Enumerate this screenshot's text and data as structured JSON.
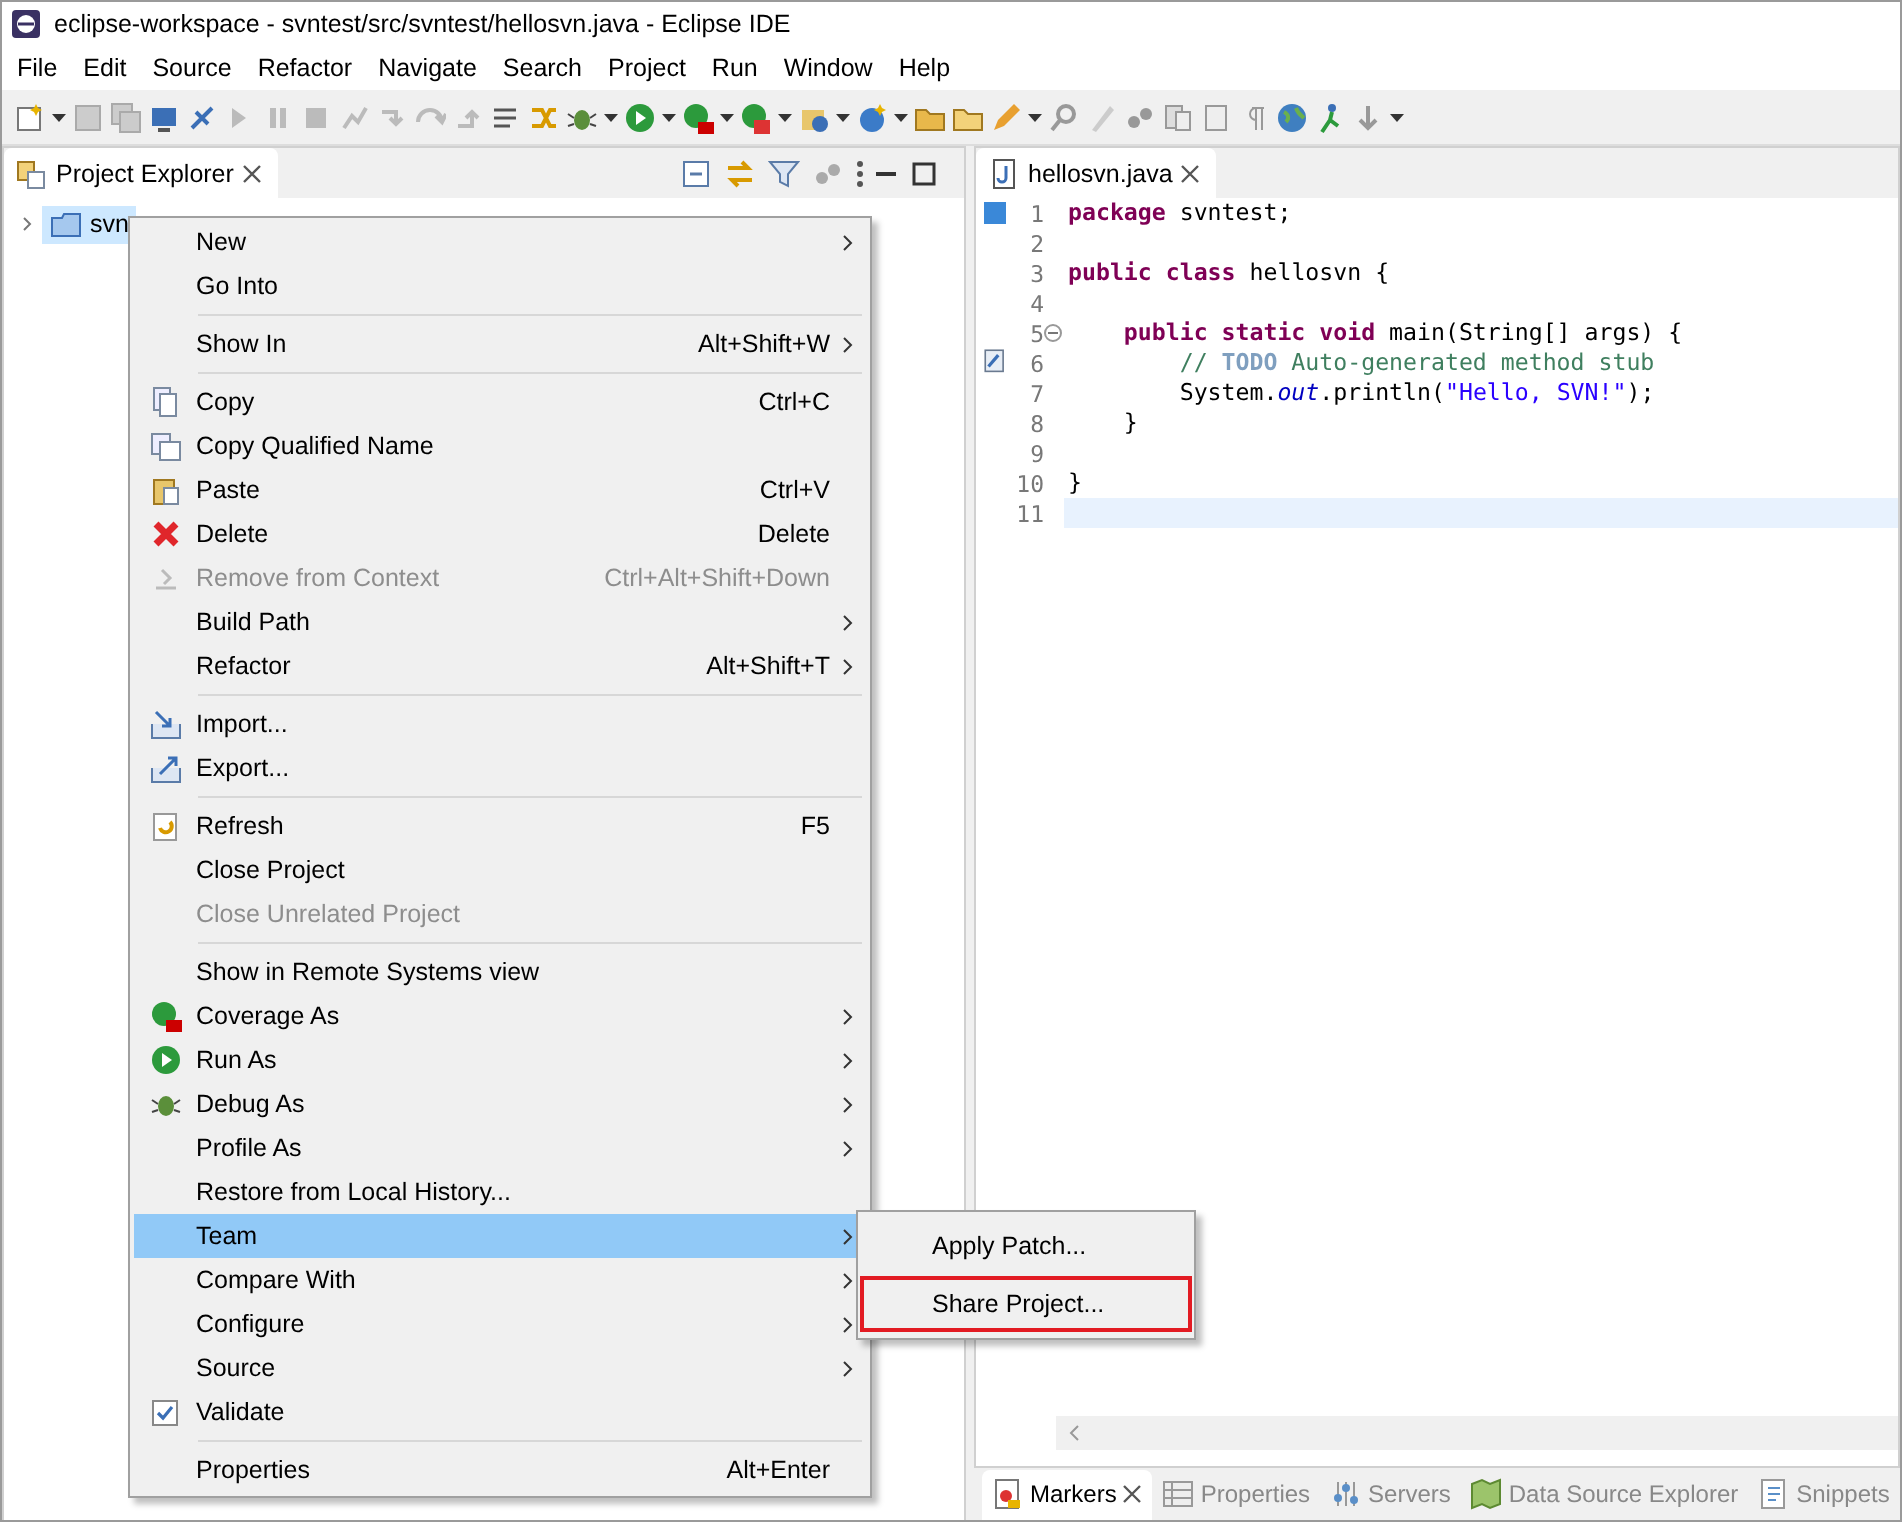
{
  "window": {
    "title": "eclipse-workspace - svntest/src/svntest/hellosvn.java - Eclipse IDE"
  },
  "menubar": [
    "File",
    "Edit",
    "Source",
    "Refactor",
    "Navigate",
    "Search",
    "Project",
    "Run",
    "Window",
    "Help"
  ],
  "explorer": {
    "tab": {
      "label": "Project Explorer",
      "selected": true
    },
    "tree": [
      {
        "label": "svn",
        "expanded": false,
        "selected": true
      }
    ]
  },
  "context_menu": [
    {
      "kind": "item",
      "label": "New",
      "submenu": true,
      "disabled": false,
      "selected": false
    },
    {
      "kind": "item",
      "label": "Go Into",
      "submenu": false,
      "disabled": false,
      "selected": false
    },
    {
      "kind": "separator"
    },
    {
      "kind": "item",
      "label": "Show In",
      "shortcut": "Alt+Shift+W",
      "submenu": true,
      "disabled": false,
      "selected": false
    },
    {
      "kind": "separator"
    },
    {
      "kind": "item",
      "label": "Copy",
      "shortcut": "Ctrl+C",
      "submenu": false,
      "disabled": false,
      "selected": false
    },
    {
      "kind": "item",
      "label": "Copy Qualified Name",
      "submenu": false,
      "disabled": false,
      "selected": false
    },
    {
      "kind": "item",
      "label": "Paste",
      "shortcut": "Ctrl+V",
      "submenu": false,
      "disabled": false,
      "selected": false
    },
    {
      "kind": "item",
      "label": "Delete",
      "shortcut": "Delete",
      "submenu": false,
      "disabled": false,
      "selected": false
    },
    {
      "kind": "item",
      "label": "Remove from Context",
      "shortcut": "Ctrl+Alt+Shift+Down",
      "submenu": false,
      "disabled": true,
      "selected": false
    },
    {
      "kind": "item",
      "label": "Build Path",
      "submenu": true,
      "disabled": false,
      "selected": false
    },
    {
      "kind": "item",
      "label": "Refactor",
      "shortcut": "Alt+Shift+T",
      "submenu": true,
      "disabled": false,
      "selected": false
    },
    {
      "kind": "separator"
    },
    {
      "kind": "item",
      "label": "Import...",
      "submenu": false,
      "disabled": false,
      "selected": false
    },
    {
      "kind": "item",
      "label": "Export...",
      "submenu": false,
      "disabled": false,
      "selected": false
    },
    {
      "kind": "separator"
    },
    {
      "kind": "item",
      "label": "Refresh",
      "shortcut": "F5",
      "submenu": false,
      "disabled": false,
      "selected": false
    },
    {
      "kind": "item",
      "label": "Close Project",
      "submenu": false,
      "disabled": false,
      "selected": false
    },
    {
      "kind": "item",
      "label": "Close Unrelated Project",
      "submenu": false,
      "disabled": true,
      "selected": false
    },
    {
      "kind": "separator"
    },
    {
      "kind": "item",
      "label": "Show in Remote Systems view",
      "submenu": false,
      "disabled": false,
      "selected": false
    },
    {
      "kind": "item",
      "label": "Coverage As",
      "submenu": true,
      "disabled": false,
      "selected": false
    },
    {
      "kind": "item",
      "label": "Run As",
      "submenu": true,
      "disabled": false,
      "selected": false
    },
    {
      "kind": "item",
      "label": "Debug As",
      "submenu": true,
      "disabled": false,
      "selected": false
    },
    {
      "kind": "item",
      "label": "Profile As",
      "submenu": true,
      "disabled": false,
      "selected": false
    },
    {
      "kind": "item",
      "label": "Restore from Local History...",
      "submenu": false,
      "disabled": false,
      "selected": false
    },
    {
      "kind": "item",
      "label": "Team",
      "submenu": true,
      "disabled": false,
      "selected": true
    },
    {
      "kind": "item",
      "label": "Compare With",
      "submenu": true,
      "disabled": false,
      "selected": false
    },
    {
      "kind": "item",
      "label": "Configure",
      "submenu": true,
      "disabled": false,
      "selected": false
    },
    {
      "kind": "item",
      "label": "Source",
      "submenu": true,
      "disabled": false,
      "selected": false
    },
    {
      "kind": "check",
      "label": "Validate",
      "checked": true,
      "submenu": false,
      "disabled": false,
      "selected": false
    },
    {
      "kind": "separator"
    },
    {
      "kind": "item",
      "label": "Properties",
      "shortcut": "Alt+Enter",
      "submenu": false,
      "disabled": false,
      "selected": false
    }
  ],
  "team_submenu": [
    {
      "label": "Apply Patch...",
      "outlined": false
    },
    {
      "label": "Share Project...",
      "outlined": true
    }
  ],
  "editor": {
    "tab": {
      "label": "hellosvn.java",
      "selected": true
    },
    "lines": [
      {
        "number": "1",
        "changed": true,
        "foldable": false,
        "task": false,
        "current": false,
        "segments": [
          {
            "kind": "keyword",
            "text": "package "
          },
          {
            "kind": "plain",
            "text": "svntest;"
          }
        ]
      },
      {
        "number": "2",
        "changed": false,
        "foldable": false,
        "task": false,
        "current": false
      },
      {
        "number": "3",
        "changed": false,
        "foldable": false,
        "task": false,
        "current": false,
        "segments": [
          {
            "kind": "keyword",
            "text": "public class "
          },
          {
            "kind": "plain",
            "text": "hellosvn {"
          }
        ]
      },
      {
        "number": "4",
        "changed": false,
        "foldable": false,
        "task": false,
        "current": false
      },
      {
        "number": "5",
        "changed": false,
        "foldable": true,
        "task": false,
        "current": false,
        "segments": [
          {
            "kind": "keyword",
            "text": "    public static void "
          },
          {
            "kind": "plain",
            "text": "main(String[] args) {"
          }
        ]
      },
      {
        "number": "6",
        "changed": false,
        "foldable": false,
        "task": true,
        "current": false,
        "segments": [
          {
            "kind": "comment",
            "text": "        // "
          },
          {
            "kind": "todo",
            "text": "TODO"
          },
          {
            "kind": "comment",
            "text": " Auto-generated method stub"
          }
        ]
      },
      {
        "number": "7",
        "changed": false,
        "foldable": false,
        "task": false,
        "current": false,
        "segments": [
          {
            "kind": "plain",
            "text": "        System."
          },
          {
            "kind": "field",
            "text": "out"
          },
          {
            "kind": "plain",
            "text": ".println("
          },
          {
            "kind": "string",
            "text": "\"Hello, SVN!\""
          },
          {
            "kind": "plain",
            "text": ");"
          }
        ]
      },
      {
        "number": "8",
        "changed": false,
        "foldable": false,
        "task": false,
        "current": false,
        "segments": [
          {
            "kind": "plain",
            "text": "    }"
          }
        ]
      },
      {
        "number": "9",
        "changed": false,
        "foldable": false,
        "task": false,
        "current": false
      },
      {
        "number": "10",
        "changed": false,
        "foldable": false,
        "task": false,
        "current": false,
        "segments": [
          {
            "kind": "plain",
            "text": "}"
          }
        ]
      },
      {
        "number": "11",
        "changed": false,
        "foldable": false,
        "task": false,
        "current": true
      }
    ]
  },
  "bottom_tabs": [
    {
      "label": "Markers",
      "selected": true,
      "closable": true
    },
    {
      "label": "Properties",
      "selected": false,
      "closable": false
    },
    {
      "label": "Servers",
      "selected": false,
      "closable": false
    },
    {
      "label": "Data Source Explorer",
      "selected": false,
      "closable": false
    },
    {
      "label": "Snippets",
      "selected": false,
      "closable": false
    }
  ]
}
